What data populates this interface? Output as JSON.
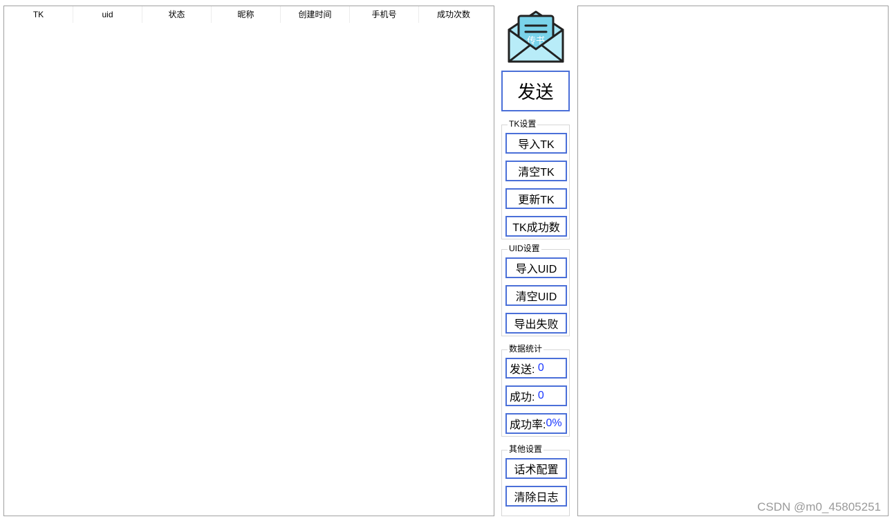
{
  "table": {
    "columns": [
      "TK",
      "uid",
      "状态",
      "昵称",
      "创建时间",
      "手机号",
      "成功次数"
    ]
  },
  "logo": {
    "icon": "envelope-letter-icon",
    "text": "传书"
  },
  "send_button": "发送",
  "tk_group": {
    "title": "TK设置",
    "buttons": [
      "导入TK",
      "清空TK",
      "更新TK",
      "TK成功数"
    ]
  },
  "uid_group": {
    "title": "UID设置",
    "buttons": [
      "导入UID",
      "清空UID",
      "导出失败"
    ]
  },
  "stats_group": {
    "title": "数据统计",
    "send_label": "发送:",
    "send_value": "0",
    "success_label": "成功:",
    "success_value": "0",
    "rate_label": "成功率:",
    "rate_value": "0%"
  },
  "other_group": {
    "title": "其他设置",
    "buttons": [
      "话术配置",
      "清除日志"
    ]
  },
  "watermark": "CSDN @m0_45805251",
  "colors": {
    "accent": "#4a6fd8",
    "value": "#1a37ff",
    "envelope": "#a8e6f5"
  }
}
